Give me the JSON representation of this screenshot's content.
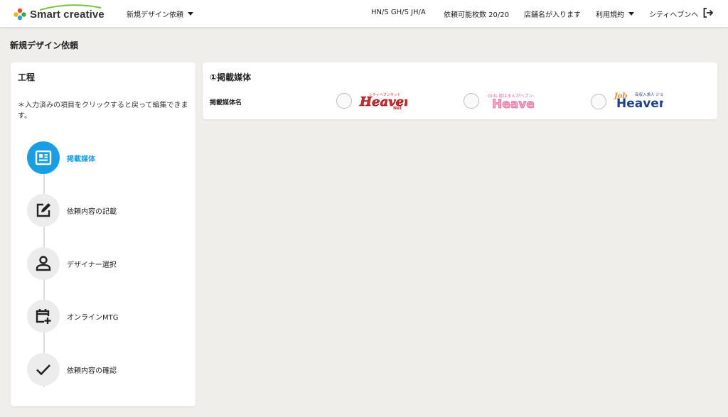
{
  "header": {
    "brand": "Smart creative",
    "nav_dropdown": "新規デザイン依頼",
    "codes": "HN/S GH/S JH/A",
    "quota": "依頼可能枚数 20/20",
    "store_name": "店舗名が入ります",
    "terms": "利用規約",
    "city_heaven": "シティヘブンへ"
  },
  "page_title": "新規デザイン依頼",
  "process": {
    "title": "工程",
    "note": "＊入力済みの項目をクリックすると戻って編集できます。",
    "steps": [
      {
        "label": "掲載媒体",
        "icon": "newspaper-icon",
        "active": true
      },
      {
        "label": "依頼内容の記載",
        "icon": "edit-icon",
        "active": false
      },
      {
        "label": "デザイナー選択",
        "icon": "person-icon",
        "active": false
      },
      {
        "label": "オンラインMTG",
        "icon": "calendar-plus-icon",
        "active": false
      },
      {
        "label": "依頼内容の確認",
        "icon": "checkmark-icon",
        "active": false
      }
    ]
  },
  "media": {
    "title": "①掲載媒体",
    "field_label": "掲載媒体名",
    "options": [
      {
        "logo": "heaven-net-logo",
        "logo_small_text": "シティヘブンネット",
        "logo_main_text": "Heaven"
      },
      {
        "logo": "girls-heaven-logo",
        "logo_small_text": "Girls 姫はまんがヘブン",
        "logo_main_text": "Heaven"
      },
      {
        "logo": "job-heaven-logo",
        "logo_small_text": "高収入求人 ジョブヘブン",
        "logo_main_text": "Heaven"
      }
    ]
  },
  "colors": {
    "accent": "#1a9ee3",
    "background": "#efeeeb",
    "heaven_red": "#d42a2a",
    "girls_pink": "#e8659a",
    "job_navy": "#1d3f8a",
    "job_orange": "#f08a24"
  }
}
